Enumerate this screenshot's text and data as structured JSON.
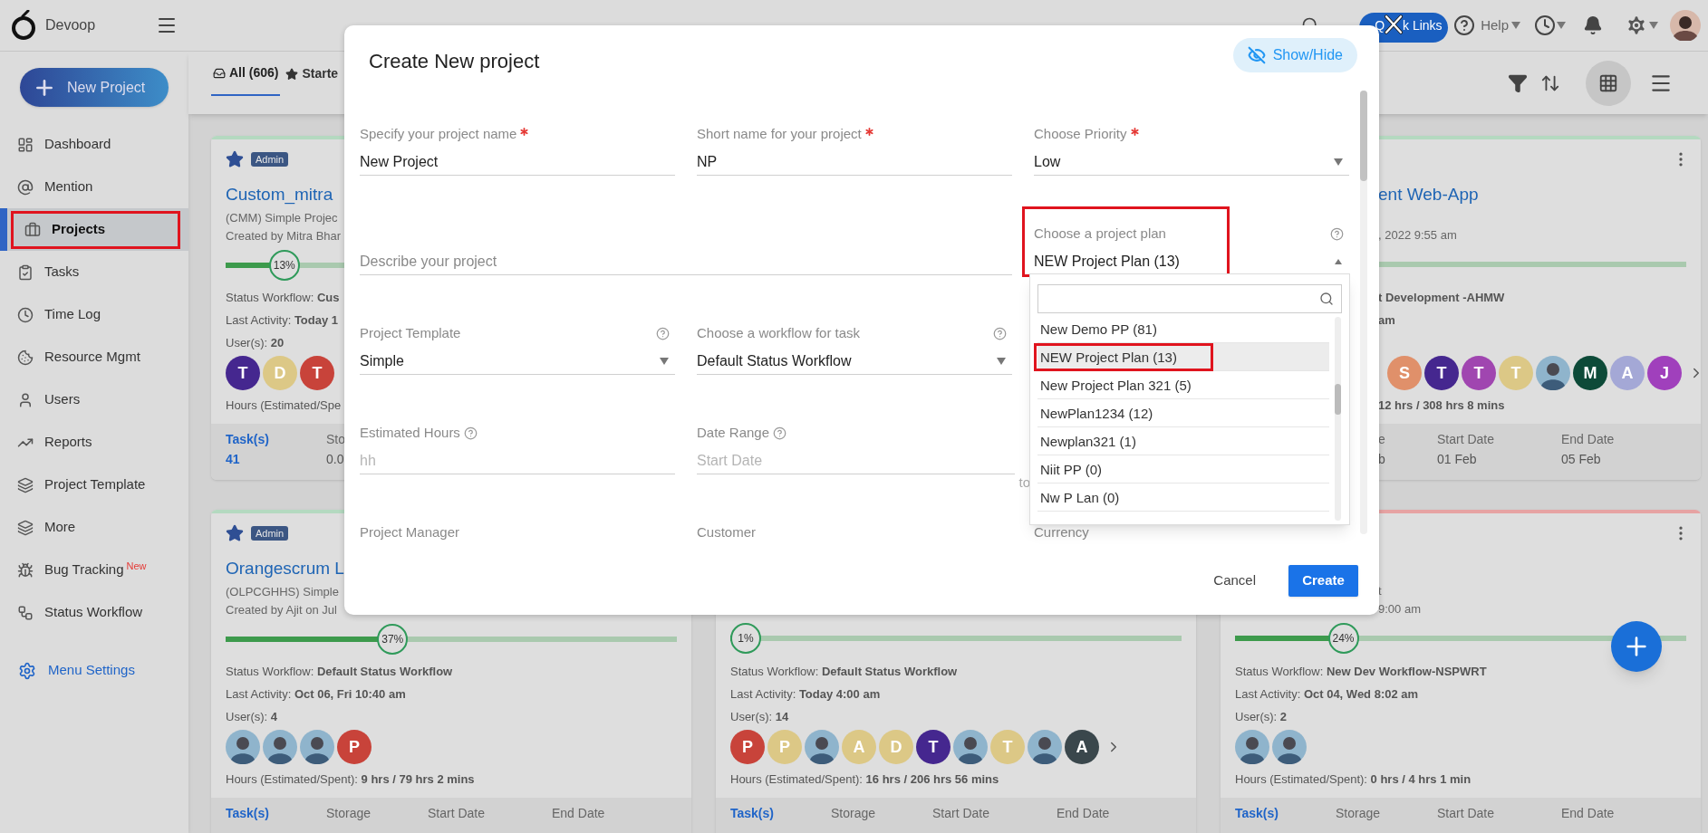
{
  "topbar": {
    "brand": "Devoop",
    "quick_links": {
      "label_start": "Q",
      "label_end": "k Links",
      "crossed_out": true
    },
    "help": "Help"
  },
  "sidebar": {
    "new_project": "New Project",
    "items": [
      {
        "label": "Dashboard",
        "selected": false,
        "highlighted": false
      },
      {
        "label": "Mention",
        "selected": false,
        "highlighted": false
      },
      {
        "label": "Projects",
        "selected": true,
        "highlighted": true
      },
      {
        "label": "Tasks",
        "selected": false,
        "highlighted": false
      },
      {
        "label": "Time Log",
        "selected": false,
        "highlighted": false
      },
      {
        "label": "Resource Mgmt",
        "selected": false,
        "highlighted": false
      },
      {
        "label": "Users",
        "selected": false,
        "highlighted": false
      },
      {
        "label": "Reports",
        "selected": false,
        "highlighted": false
      },
      {
        "label": "Project Template",
        "selected": false,
        "highlighted": false
      },
      {
        "label": "More",
        "selected": false,
        "highlighted": false
      },
      {
        "label": "Bug Tracking",
        "badge": "New",
        "selected": false,
        "highlighted": false
      },
      {
        "label": "Status Workflow",
        "selected": false,
        "highlighted": false
      }
    ],
    "menu_settings": "Menu Settings"
  },
  "tabs": [
    {
      "label": "All (606)",
      "selected": true
    },
    {
      "label": "Starte",
      "selected": false
    }
  ],
  "cards": [
    {
      "color": "#b4d9c0",
      "starred": true,
      "badge": "Admin",
      "title": "Custom_mitra",
      "subtitle": "(CMM) Simple Projec",
      "created": "Created by Mitra Bhar",
      "progress": {
        "level": 0.13,
        "label": "13%"
      },
      "status": "Status Workflow: **Cus**",
      "activity": "Last Activity: **Today 1**",
      "users": "User(s): **20**",
      "avatars": [
        {
          "kind": "letter",
          "letter": "T",
          "color": "#45278f"
        },
        {
          "kind": "letter",
          "letter": "D",
          "color": "#dcc886"
        },
        {
          "kind": "letter",
          "letter": "T",
          "color": "#c8433a"
        }
      ],
      "hours": "Hours (Estimated/Spe",
      "footer": {
        "tasks": {
          "label": "Task(s)",
          "value": "41"
        },
        "storage": {
          "label": "Sto",
          "value": "0.0"
        }
      }
    },
    {
      "color": "#b4d9c0",
      "menu": true,
      "title": "ent Web-App",
      "created": ", 2022 9:55 am",
      "status": "**t Development -AHMW**",
      "activity": "**am**",
      "avatars": [
        {
          "kind": "letter",
          "letter": "S",
          "color": "#e0906a"
        },
        {
          "kind": "letter",
          "letter": "T",
          "color": "#45278f"
        },
        {
          "kind": "letter",
          "letter": "T",
          "color": "#a046b0"
        },
        {
          "kind": "letter",
          "letter": "T",
          "color": "#dcc886"
        },
        {
          "kind": "photo"
        },
        {
          "kind": "letter",
          "letter": "M",
          "color": "#0d4a38"
        },
        {
          "kind": "letter",
          "letter": "A",
          "color": "#a4a8d6"
        },
        {
          "kind": "letter",
          "letter": "J",
          "color": "#a040bc"
        }
      ],
      "more": true,
      "hours": "**12 hrs / 308 hrs 8 mins**",
      "footer": {
        "storage": {
          "label": "e",
          "value": "b"
        },
        "start": {
          "label": "Start Date",
          "value": "01 Feb"
        },
        "end": {
          "label": "End Date",
          "value": "05 Feb"
        }
      }
    },
    {
      "color": "#b4d9c0",
      "starred": true,
      "badge": "Admin",
      "title": "Orangescrum L",
      "subtitle": "(OLPCGHHS) Simple",
      "created": "Created by Ajit on Jul",
      "progress": {
        "level": 0.37,
        "label": "37%"
      },
      "status": "Status Workflow: **Default Status Workflow**",
      "activity": "Last Activity: **Oct 06, Fri 10:40 am**",
      "users": "User(s): **4**",
      "avatars": [
        {
          "kind": "photo"
        },
        {
          "kind": "photo"
        },
        {
          "kind": "photo"
        },
        {
          "kind": "letter",
          "letter": "P",
          "color": "#c8433a"
        }
      ],
      "hours": "Hours (Estimated/Spent): **9 hrs / 79 hrs 2 mins**",
      "footer": {
        "tasks": {
          "label": "Task(s)"
        },
        "storage": {
          "label": "Storage"
        },
        "start": {
          "label": "Start Date"
        },
        "end": {
          "label": "End Date"
        }
      }
    },
    {
      "progress": {
        "level": 0.01,
        "label": "1%"
      },
      "status": "Status Workflow: **Default Status Workflow**",
      "activity": "Last Activity: **Today 4:00 am**",
      "users": "User(s): **14**",
      "avatars": [
        {
          "kind": "letter",
          "letter": "P",
          "color": "#c8433a"
        },
        {
          "kind": "letter",
          "letter": "P",
          "color": "#dcc886"
        },
        {
          "kind": "photo"
        },
        {
          "kind": "letter",
          "letter": "A",
          "color": "#dcc886"
        },
        {
          "kind": "letter",
          "letter": "D",
          "color": "#dcc886"
        },
        {
          "kind": "letter",
          "letter": "T",
          "color": "#45278f"
        },
        {
          "kind": "photo"
        },
        {
          "kind": "letter",
          "letter": "T",
          "color": "#dcc886"
        },
        {
          "kind": "photo"
        },
        {
          "kind": "letter",
          "letter": "A",
          "color": "#3a474c"
        }
      ],
      "more": true,
      "hours": "Hours (Estimated/Spent): **16 hrs / 206 hrs 56 mins**",
      "footer": {
        "tasks": {
          "label": "Task(s)"
        },
        "storage": {
          "label": "Storage"
        },
        "start": {
          "label": "Start Date"
        },
        "end": {
          "label": "End Date"
        }
      }
    },
    {
      "color": "#e6a3a3",
      "menu": true,
      "subtitle": "t",
      "created": "9:00 am",
      "progress": {
        "level": 0.24,
        "label": "24%"
      },
      "status": "Status Workflow: **New Dev Workflow-NSPWRT**",
      "activity": "Last Activity: **Oct 04, Wed 8:02 am**",
      "users": "User(s): **2**",
      "avatars": [
        {
          "kind": "photo"
        },
        {
          "kind": "photo"
        }
      ],
      "hours": "Hours (Estimated/Spent): **0 hrs / 4 hrs 1 min**",
      "footer": {
        "tasks": {
          "label": "Task(s)"
        },
        "storage": {
          "label": "Storage"
        },
        "start": {
          "label": "Start Date"
        },
        "end": {
          "label": "End Date"
        }
      }
    }
  ],
  "modal": {
    "title": "Create New project",
    "show_hide": "Show/Hide",
    "rows": [
      [
        {
          "kind": "text",
          "label": "Specify your project name",
          "required": true,
          "value": "New Project"
        },
        {
          "kind": "text",
          "label": "Short name for your project",
          "required": true,
          "value": "NP"
        },
        {
          "kind": "select",
          "label": "Choose Priority",
          "required": true,
          "value": "Low"
        }
      ],
      [
        {
          "kind": "textarea",
          "placeholder": "Describe your project"
        },
        "",
        {
          "kind": "select",
          "label": "Choose a project plan",
          "help": true,
          "value": "NEW Project Plan (13)",
          "open": true,
          "highlighted": true
        }
      ],
      [
        {
          "kind": "select",
          "label": "Project Template",
          "help": true,
          "value": "Simple"
        },
        {
          "kind": "select",
          "label": "Choose a workflow for task",
          "help": true,
          "value": "Default Status Workflow"
        }
      ],
      [
        {
          "kind": "text",
          "label": "Estimated Hours",
          "help": true,
          "placeholder": "hh"
        },
        {
          "kind": "text",
          "label": "Date Range",
          "help": true,
          "placeholder": "Start Date",
          "suffix": "to"
        }
      ],
      [
        {
          "kind": "select",
          "label": "Project Manager"
        },
        {
          "kind": "select",
          "label": "Customer"
        },
        {
          "kind": "select",
          "label": "Currency"
        }
      ]
    ],
    "plan_options": [
      {
        "label": "New Demo PP (81)",
        "selected": false,
        "highlighted": false
      },
      {
        "label": "NEW Project Plan (13)",
        "selected": true,
        "highlighted": true
      },
      {
        "label": "New Project Plan 321 (5)",
        "selected": false,
        "highlighted": false
      },
      {
        "label": "NewPlan1234 (12)",
        "selected": false,
        "highlighted": false
      },
      {
        "label": "Newplan321 (1)",
        "selected": false,
        "highlighted": false
      },
      {
        "label": "Niit PP (0)",
        "selected": false,
        "highlighted": false
      },
      {
        "label": "Nw P Lan (0)",
        "selected": false,
        "highlighted": false
      }
    ],
    "cancel": "Cancel",
    "create": "Create"
  }
}
